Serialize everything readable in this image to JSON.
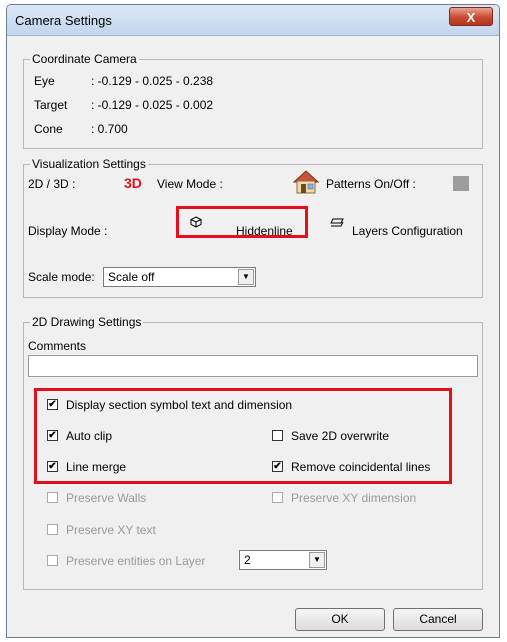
{
  "window": {
    "title": "Camera Settings",
    "close_glyph": "X"
  },
  "coordinate": {
    "title": "Coordinate Camera",
    "eye_label": "Eye",
    "eye_value": ": -0.129 - 0.025 - 0.238",
    "target_label": "Target",
    "target_value": ": -0.129 - 0.025 - 0.002",
    "cone_label": "Cone",
    "cone_value": ": 0.700"
  },
  "visualization": {
    "title": "Visualization Settings",
    "dim_label": "2D / 3D :",
    "dim_value": "3D",
    "view_mode_label": "View Mode :",
    "patterns_label": "Patterns On/Off :",
    "display_mode_label": "Display Mode :",
    "display_mode_value": "Hiddenline",
    "layers_label": "Layers Configuration",
    "scale_label": "Scale mode:",
    "scale_value": "Scale off"
  },
  "drawing": {
    "title": "2D Drawing Settings",
    "comments_label": "Comments",
    "comments_value": "",
    "display_section": "Display section symbol text and dimension",
    "auto_clip": "Auto clip",
    "save_overwrite": "Save 2D overwrite",
    "line_merge": "Line merge",
    "remove_coincidental": "Remove coincidental lines",
    "preserve_walls": "Preserve Walls",
    "preserve_xy_dimension": "Preserve XY dimension",
    "preserve_xy_text": "Preserve XY text",
    "preserve_entities": "Preserve entities on Layer",
    "layer_value": "2"
  },
  "checks": {
    "display_section": true,
    "auto_clip": true,
    "save_overwrite": false,
    "line_merge": true,
    "remove_coincidental": true,
    "preserve_walls": false,
    "preserve_xy_dimension": false,
    "preserve_xy_text": false,
    "preserve_entities": false
  },
  "buttons": {
    "ok": "OK",
    "cancel": "Cancel"
  },
  "icons": {
    "view_mode": "house-icon",
    "display_mode": "cube-icon",
    "layers": "layers-icon"
  },
  "colors": {
    "highlight": "#e3101c",
    "dim_value": "#e3101c",
    "patterns_swatch": "#9c9c9c"
  },
  "check_glyph": "✔"
}
